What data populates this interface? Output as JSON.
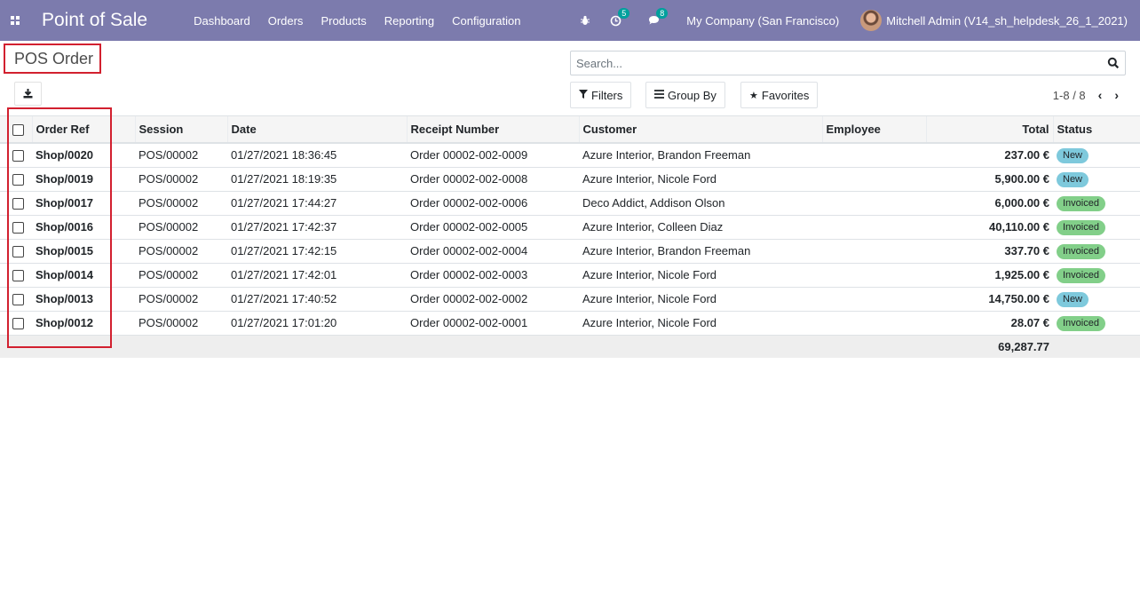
{
  "navbar": {
    "app_title": "Point of Sale",
    "menu": [
      "Dashboard",
      "Orders",
      "Products",
      "Reporting",
      "Configuration"
    ],
    "activity_count": "5",
    "message_count": "8",
    "company": "My Company (San Francisco)",
    "user": "Mitchell Admin (V14_sh_helpdesk_26_1_2021)"
  },
  "control_panel": {
    "title": "POS Order",
    "search_placeholder": "Search...",
    "filters_label": "Filters",
    "group_by_label": "Group By",
    "favorites_label": "Favorites",
    "pager": "1-8 / 8"
  },
  "table": {
    "columns": [
      "Order Ref",
      "Session",
      "Date",
      "Receipt Number",
      "Customer",
      "Employee",
      "Total",
      "Status"
    ],
    "rows": [
      {
        "ref": "Shop/0020",
        "session": "POS/00002",
        "date": "01/27/2021 18:36:45",
        "receipt": "Order 00002-002-0009",
        "customer": "Azure Interior, Brandon Freeman",
        "employee": "",
        "total": "237.00 €",
        "status": "New"
      },
      {
        "ref": "Shop/0019",
        "session": "POS/00002",
        "date": "01/27/2021 18:19:35",
        "receipt": "Order 00002-002-0008",
        "customer": "Azure Interior, Nicole Ford",
        "employee": "",
        "total": "5,900.00 €",
        "status": "New"
      },
      {
        "ref": "Shop/0017",
        "session": "POS/00002",
        "date": "01/27/2021 17:44:27",
        "receipt": "Order 00002-002-0006",
        "customer": "Deco Addict, Addison Olson",
        "employee": "",
        "total": "6,000.00 €",
        "status": "Invoiced"
      },
      {
        "ref": "Shop/0016",
        "session": "POS/00002",
        "date": "01/27/2021 17:42:37",
        "receipt": "Order 00002-002-0005",
        "customer": "Azure Interior, Colleen Diaz",
        "employee": "",
        "total": "40,110.00 €",
        "status": "Invoiced"
      },
      {
        "ref": "Shop/0015",
        "session": "POS/00002",
        "date": "01/27/2021 17:42:15",
        "receipt": "Order 00002-002-0004",
        "customer": "Azure Interior, Brandon Freeman",
        "employee": "",
        "total": "337.70 €",
        "status": "Invoiced"
      },
      {
        "ref": "Shop/0014",
        "session": "POS/00002",
        "date": "01/27/2021 17:42:01",
        "receipt": "Order 00002-002-0003",
        "customer": "Azure Interior, Nicole Ford",
        "employee": "",
        "total": "1,925.00 €",
        "status": "Invoiced"
      },
      {
        "ref": "Shop/0013",
        "session": "POS/00002",
        "date": "01/27/2021 17:40:52",
        "receipt": "Order 00002-002-0002",
        "customer": "Azure Interior, Nicole Ford",
        "employee": "",
        "total": "14,750.00 €",
        "status": "New"
      },
      {
        "ref": "Shop/0012",
        "session": "POS/00002",
        "date": "01/27/2021 17:01:20",
        "receipt": "Order 00002-002-0001",
        "customer": "Azure Interior, Nicole Ford",
        "employee": "",
        "total": "28.07 €",
        "status": "Invoiced"
      }
    ],
    "footer_total": "69,287.77"
  },
  "colors": {
    "navbar": "#7c7bad",
    "status_new": "#7ec9dc",
    "status_invoiced": "#82cf89",
    "highlight": "#d2202f"
  }
}
